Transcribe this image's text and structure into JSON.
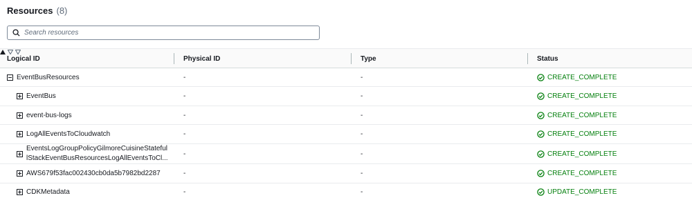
{
  "header": {
    "title": "Resources",
    "count": "(8)"
  },
  "search": {
    "placeholder": "Search resources"
  },
  "columns": {
    "logical_id": "Logical ID",
    "physical_id": "Physical ID",
    "type": "Type",
    "status": "Status"
  },
  "rows": [
    {
      "logical_line1": "EventBusResources",
      "logical_line2": "",
      "expanded": true,
      "physical": "-",
      "type": "-",
      "status": "CREATE_COMPLETE"
    },
    {
      "logical_line1": "EventBus",
      "logical_line2": "",
      "expanded": false,
      "physical": "-",
      "type": "-",
      "status": "CREATE_COMPLETE"
    },
    {
      "logical_line1": "event-bus-logs",
      "logical_line2": "",
      "expanded": false,
      "physical": "-",
      "type": "-",
      "status": "CREATE_COMPLETE"
    },
    {
      "logical_line1": "LogAllEventsToCloudwatch",
      "logical_line2": "",
      "expanded": false,
      "physical": "-",
      "type": "-",
      "status": "CREATE_COMPLETE"
    },
    {
      "logical_line1": "EventsLogGroupPolicyGilmoreCuisineStateful",
      "logical_line2": "lStackEventBusResourcesLogAllEventsToCl...",
      "expanded": false,
      "physical": "-",
      "type": "-",
      "status": "CREATE_COMPLETE"
    },
    {
      "logical_line1": "AWS679f53fac002430cb0da5b7982bd2287",
      "logical_line2": "",
      "expanded": false,
      "physical": "-",
      "type": "-",
      "status": "CREATE_COMPLETE"
    },
    {
      "logical_line1": "CDKMetadata",
      "logical_line2": "",
      "expanded": false,
      "physical": "-",
      "type": "-",
      "status": "UPDATE_COMPLETE"
    }
  ],
  "colors": {
    "success": "#037f0c",
    "border": "#e9ebed",
    "text": "#16191f"
  }
}
